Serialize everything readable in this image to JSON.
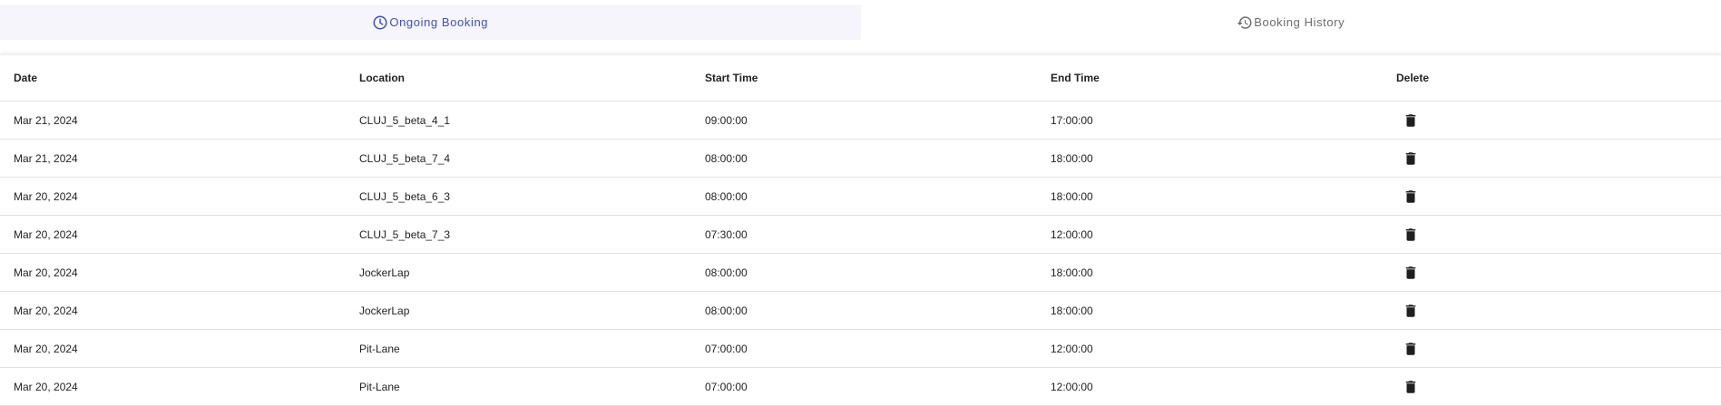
{
  "tabs": [
    {
      "label": "Ongoing Booking",
      "icon": "clock-icon",
      "active": true
    },
    {
      "label": "Booking History",
      "icon": "history-icon",
      "active": false
    }
  ],
  "colors": {
    "accent": "#3f51b5",
    "active_tab_bg": "#f5f5fb",
    "inactive_tab_text": "#6b6b6b",
    "row_border": "#e0e0e0"
  },
  "table": {
    "headers": {
      "date": "Date",
      "location": "Location",
      "start": "Start Time",
      "end": "End Time",
      "delete": "Delete"
    },
    "delete_icon": "trash-icon",
    "rows": [
      {
        "date": "Mar 21, 2024",
        "location": "CLUJ_5_beta_4_1",
        "start": "09:00:00",
        "end": "17:00:00"
      },
      {
        "date": "Mar 21, 2024",
        "location": "CLUJ_5_beta_7_4",
        "start": "08:00:00",
        "end": "18:00:00"
      },
      {
        "date": "Mar 20, 2024",
        "location": "CLUJ_5_beta_6_3",
        "start": "08:00:00",
        "end": "18:00:00"
      },
      {
        "date": "Mar 20, 2024",
        "location": "CLUJ_5_beta_7_3",
        "start": "07:30:00",
        "end": "12:00:00"
      },
      {
        "date": "Mar 20, 2024",
        "location": "JockerLap",
        "start": "08:00:00",
        "end": "18:00:00"
      },
      {
        "date": "Mar 20, 2024",
        "location": "JockerLap",
        "start": "08:00:00",
        "end": "18:00:00"
      },
      {
        "date": "Mar 20, 2024",
        "location": "Pit-Lane",
        "start": "07:00:00",
        "end": "12:00:00"
      },
      {
        "date": "Mar 20, 2024",
        "location": "Pit-Lane",
        "start": "07:00:00",
        "end": "12:00:00"
      }
    ]
  }
}
